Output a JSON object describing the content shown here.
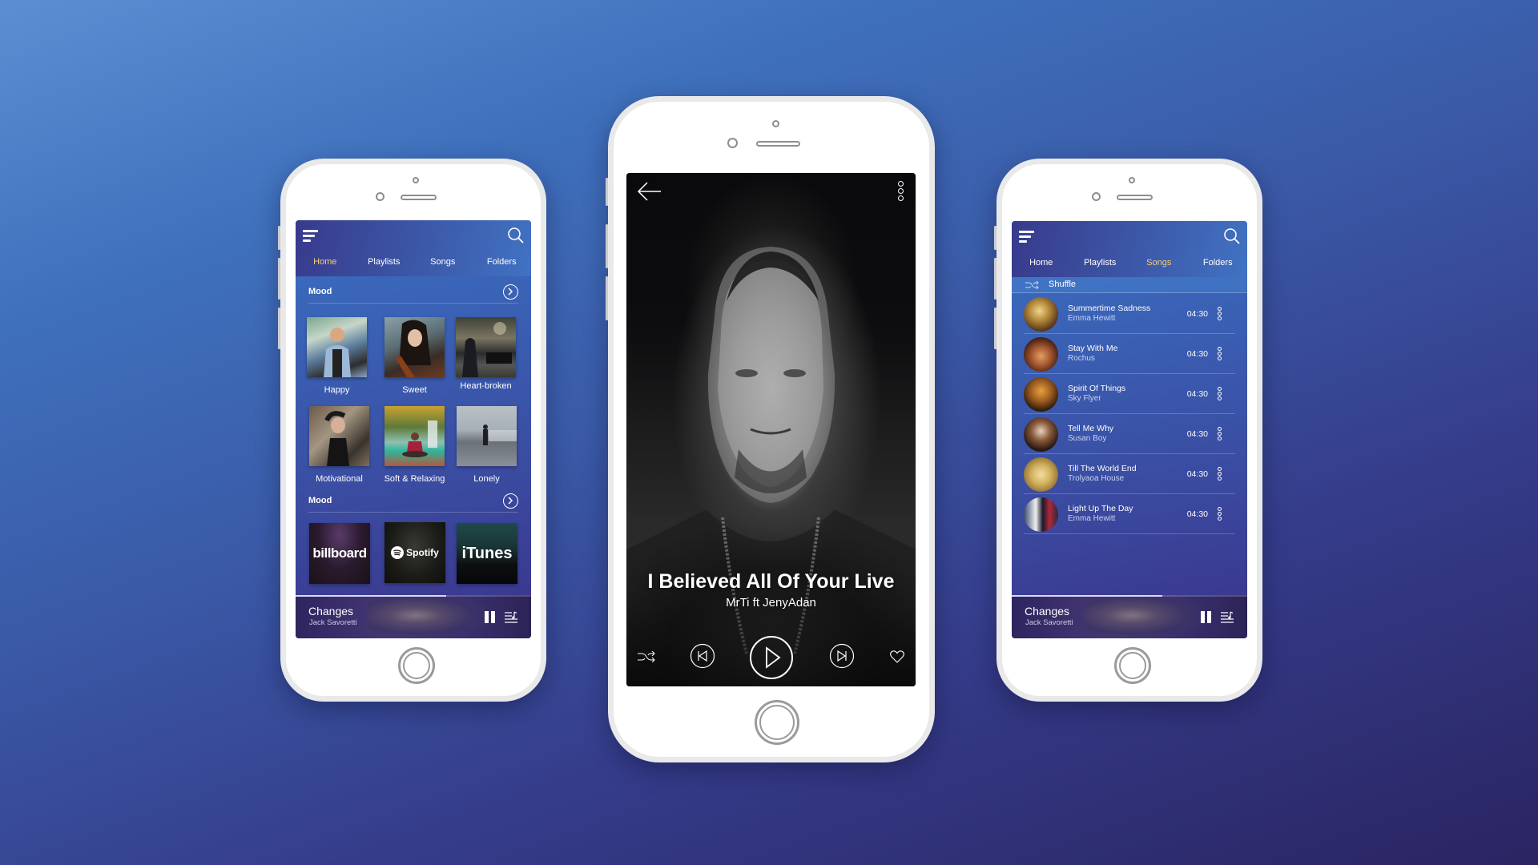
{
  "phones": {
    "home": {
      "tabs": [
        {
          "label": "Home",
          "active": true
        },
        {
          "label": "Playlists",
          "active": false
        },
        {
          "label": "Songs",
          "active": false
        },
        {
          "label": "Folders",
          "active": false
        }
      ],
      "sections": [
        {
          "title": "Mood",
          "tiles": [
            {
              "label": "Happy",
              "image": "man-with-headphones-photo"
            },
            {
              "label": "Sweet",
              "image": "woman-with-violin-photo"
            },
            {
              "label": "Heart-broken",
              "image": "violinist-by-piano-photo"
            },
            {
              "label": "Motivational",
              "image": "woman-dancing-headphones-photo"
            },
            {
              "label": "Soft & Relaxing",
              "image": "meditation-waterfall-photo"
            },
            {
              "label": "Lonely",
              "image": "person-on-pier-photo"
            }
          ]
        },
        {
          "title": "Mood",
          "tiles": [
            {
              "label": "billboard"
            },
            {
              "label": "Spotify"
            },
            {
              "label": "iTunes"
            }
          ]
        }
      ],
      "mini_player": {
        "title": "Changes",
        "artist": "Jack Savoretti",
        "progress": 0.64
      }
    },
    "player": {
      "title": "I Believed All Of Your Live",
      "artist": "MrTi ft JenyAdan",
      "controls": [
        "shuffle-icon",
        "previous-icon",
        "play-icon",
        "next-icon",
        "heart-icon"
      ]
    },
    "songs": {
      "tabs": [
        {
          "label": "Home",
          "active": false
        },
        {
          "label": "Playlists",
          "active": false
        },
        {
          "label": "Songs",
          "active": true
        },
        {
          "label": "Folders",
          "active": false
        }
      ],
      "shuffle_label": "Shuffle",
      "songs": [
        {
          "title": "Summertime Sadness",
          "artist": "Emma Hewitt",
          "duration": "04:30"
        },
        {
          "title": "Stay With Me",
          "artist": "Rochus",
          "duration": "04:30"
        },
        {
          "title": "Spirit Of Things",
          "artist": "Sky Flyer",
          "duration": "04:30"
        },
        {
          "title": "Tell Me Why",
          "artist": "Susan Boy",
          "duration": "04:30"
        },
        {
          "title": "Till The World End",
          "artist": "Trolyaoa House",
          "duration": "04:30"
        },
        {
          "title": "Light Up The Day",
          "artist": "Emma Hewitt",
          "duration": "04:30"
        }
      ],
      "mini_player": {
        "title": "Changes",
        "artist": "Jack Savoretti",
        "progress": 0.64
      }
    }
  },
  "colors": {
    "accent_tab": "#f2cf73",
    "background_top": "#5b8fd2",
    "background_bottom": "#2a2462"
  }
}
